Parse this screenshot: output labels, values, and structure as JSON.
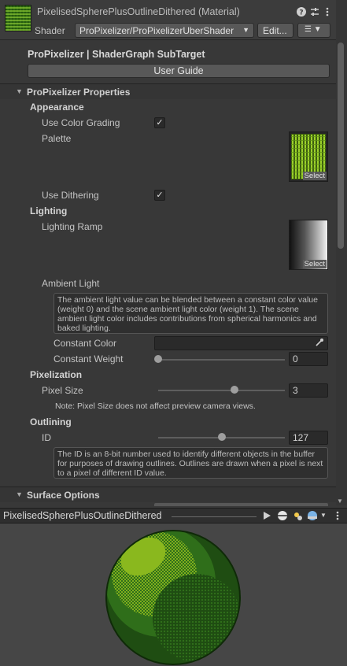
{
  "header": {
    "material_title": "PixelisedSpherePlusOutlineDithered (Material)",
    "shader_label": "Shader",
    "shader_value": "ProPixelizer/ProPixelizerUberShader",
    "edit_label": "Edit...",
    "icons": [
      "help-icon",
      "settings-sliders-icon",
      "kebab-menu-icon",
      "list-icon"
    ]
  },
  "subtarget": {
    "title": "ProPixelizer | ShaderGraph SubTarget",
    "guide_button": "User Guide"
  },
  "properties_section": "ProPixelizer Properties",
  "appearance": {
    "heading": "Appearance",
    "use_color_grading_label": "Use Color Grading",
    "use_color_grading": true,
    "palette_label": "Palette",
    "select_label": "Select",
    "use_dithering_label": "Use Dithering",
    "use_dithering": true
  },
  "lighting": {
    "heading": "Lighting",
    "ramp_label": "Lighting Ramp",
    "select_label": "Select",
    "ambient_label": "Ambient Light",
    "ambient_note": "The ambient light value can be blended between a constant color value (weight 0) and the scene ambient light color (weight 1). The scene ambient light color includes contributions from spherical harmonics and baked lighting.",
    "constant_color_label": "Constant Color",
    "constant_weight_label": "Constant Weight",
    "constant_weight_value": "0",
    "constant_weight_fraction": 0.0
  },
  "pixelization": {
    "heading": "Pixelization",
    "pixel_size_label": "Pixel Size",
    "pixel_size_value": "3",
    "pixel_size_fraction": 0.6,
    "note": "Note: Pixel Size does not affect preview camera views."
  },
  "outlining": {
    "heading": "Outlining",
    "id_label": "ID",
    "id_value": "127",
    "id_fraction": 0.5,
    "note": "The ID is an 8-bit number used to identify different objects in the buffer for purposes of drawing outlines. Outlines are drawn when a pixel is next to a pixel of different ID value."
  },
  "surface_section": "Surface Options",
  "preview": {
    "name": "PixelisedSpherePlusOutlineDithered",
    "icons": [
      "play-icon",
      "sphere-shape-icon",
      "light-icon",
      "skybox-icon",
      "dropdown-icon",
      "kebab-menu-icon"
    ]
  },
  "colors": {
    "background": "#383838",
    "sphere_dark": "#1f4d12",
    "sphere_mid": "#2f6e1a",
    "sphere_light": "#7fae1c"
  }
}
